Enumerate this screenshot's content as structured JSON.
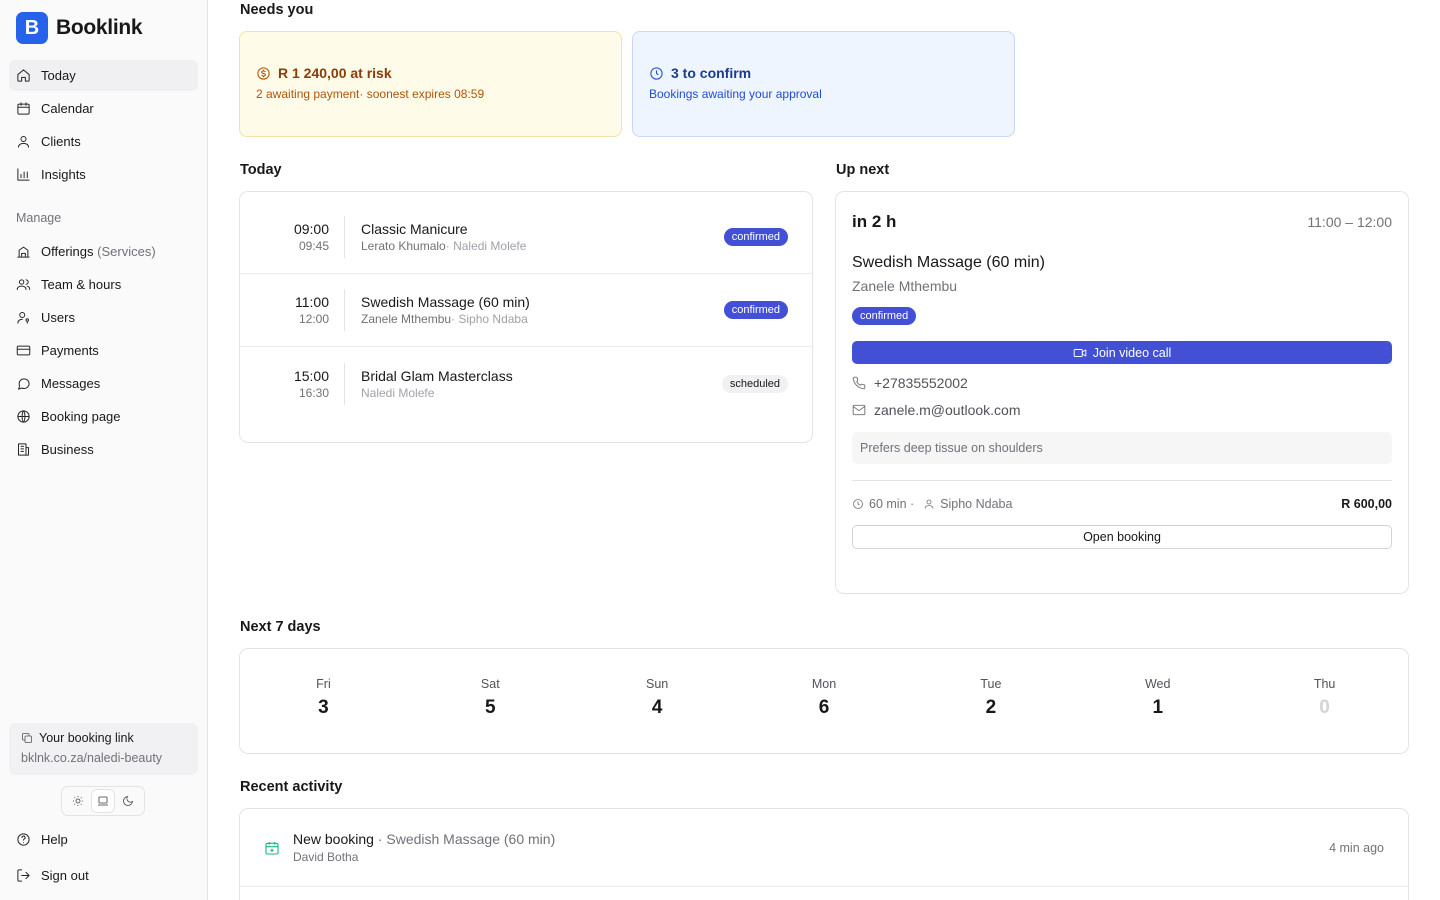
{
  "brand": {
    "logo_letter": "B",
    "name": "Booklink",
    "color": "#2563eb"
  },
  "nav": {
    "primary": [
      {
        "label": "Today",
        "icon": "home-icon",
        "active": true
      },
      {
        "label": "Calendar",
        "icon": "calendar-icon"
      },
      {
        "label": "Clients",
        "icon": "user-icon"
      },
      {
        "label": "Insights",
        "icon": "chart-icon"
      }
    ],
    "manage_label": "Manage",
    "manage": [
      {
        "label": "Offerings",
        "suffix": "(Services)",
        "icon": "building-icon"
      },
      {
        "label": "Team & hours",
        "icon": "users-icon"
      },
      {
        "label": "Users",
        "icon": "user-key-icon"
      },
      {
        "label": "Payments",
        "icon": "credit-card-icon"
      },
      {
        "label": "Messages",
        "icon": "message-icon"
      },
      {
        "label": "Booking page",
        "icon": "globe-icon"
      },
      {
        "label": "Business",
        "icon": "building-icon"
      }
    ],
    "help": "Help",
    "sign_out": "Sign out"
  },
  "booking_link": {
    "title": "Your booking link",
    "url": "bklnk.co.za/naledi-beauty"
  },
  "theme": {
    "options": [
      "sun-icon",
      "laptop-icon",
      "moon-icon"
    ],
    "selected": "laptop-icon"
  },
  "needs_you": {
    "title": "Needs you",
    "risk": {
      "headline": "R 1 240,00 at risk",
      "detail": "2 awaiting payment· soonest expires 08:59",
      "color": "#b45309"
    },
    "confirm": {
      "headline": "3 to confirm",
      "detail": "Bookings awaiting your approval",
      "color": "#1d4ed8"
    }
  },
  "today": {
    "title": "Today",
    "appointments": [
      {
        "start": "09:00",
        "end": "09:45",
        "service": "Classic Manicure",
        "client": "Lerato Khumalo",
        "staff": "· Naledi Molefe",
        "status": "confirmed"
      },
      {
        "start": "11:00",
        "end": "12:00",
        "service": "Swedish Massage (60 min)",
        "client": "Zanele Mthembu",
        "staff": "· Sipho Ndaba",
        "status": "confirmed"
      },
      {
        "start": "15:00",
        "end": "16:30",
        "service": "Bridal Glam Masterclass",
        "client": "",
        "staff": "Naledi Molefe",
        "status": "scheduled"
      }
    ]
  },
  "up_next": {
    "title": "Up next",
    "in": "in 2 h",
    "range": "11:00 – 12:00",
    "service": "Swedish Massage (60 min)",
    "client": "Zanele Mthembu",
    "status": "confirmed",
    "video_label": "Join video call",
    "phone": "+27835552002",
    "email": "zanele.m@outlook.com",
    "note": "Prefers deep tissue on shoulders",
    "duration": "60 min ·",
    "staff": "Sipho Ndaba",
    "price": "R 600,00",
    "open_label": "Open booking",
    "accent": "#4350d6"
  },
  "next_7_days": {
    "title": "Next 7 days",
    "days": [
      {
        "name": "Fri",
        "count": "3"
      },
      {
        "name": "Sat",
        "count": "5"
      },
      {
        "name": "Sun",
        "count": "4"
      },
      {
        "name": "Mon",
        "count": "6"
      },
      {
        "name": "Tue",
        "count": "2"
      },
      {
        "name": "Wed",
        "count": "1"
      },
      {
        "name": "Thu",
        "count": "0"
      }
    ]
  },
  "recent_activity": {
    "title": "Recent activity",
    "items": [
      {
        "type": "New booking",
        "service": "· Swedish Massage (60 min)",
        "who": "David Botha",
        "time": "4 min ago",
        "icon": "calendar-plus-icon",
        "color": "#10b981"
      }
    ]
  }
}
